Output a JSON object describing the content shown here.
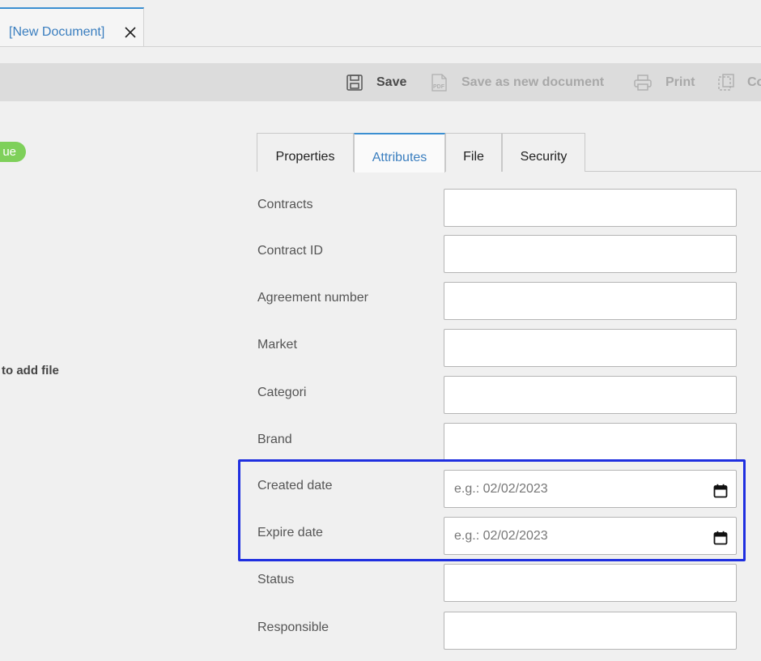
{
  "document_tab": {
    "title": "[New Document]"
  },
  "toolbar": {
    "save_label": "Save",
    "save_new_label": "Save as new document",
    "print_label": "Print",
    "copy_label": "Co"
  },
  "left_panel": {
    "status_badge_text": "ue",
    "add_file_text": "to add file"
  },
  "property_tabs": [
    {
      "label": "Properties",
      "active": false
    },
    {
      "label": "Attributes",
      "active": true
    },
    {
      "label": "File",
      "active": false
    },
    {
      "label": "Security",
      "active": false
    }
  ],
  "fields": {
    "contracts": {
      "label": "Contracts",
      "value": ""
    },
    "contract_id": {
      "label": "Contract ID",
      "value": ""
    },
    "agreement_number": {
      "label": "Agreement number",
      "value": ""
    },
    "market": {
      "label": "Market",
      "value": ""
    },
    "categori": {
      "label": "Categori",
      "value": ""
    },
    "brand": {
      "label": "Brand",
      "value": ""
    },
    "created_date": {
      "label": "Created date",
      "value": "",
      "placeholder": "e.g.: 02/02/2023"
    },
    "expire_date": {
      "label": "Expire date",
      "value": "",
      "placeholder": "e.g.: 02/02/2023"
    },
    "status": {
      "label": "Status",
      "value": ""
    },
    "responsible": {
      "label": "Responsible",
      "value": ""
    }
  },
  "icons": {
    "close": "close-icon",
    "save": "save-icon",
    "pdf": "pdf-icon",
    "print": "printer-icon",
    "copy": "copy-icon",
    "calendar": "calendar-icon"
  },
  "colors": {
    "accent": "#3b8fd1",
    "tab_text_active": "#3a7ebf",
    "badge_green": "#7ed05a",
    "highlight_box": "#1f2fe0",
    "toolbar_bg": "#dcdcdc"
  }
}
